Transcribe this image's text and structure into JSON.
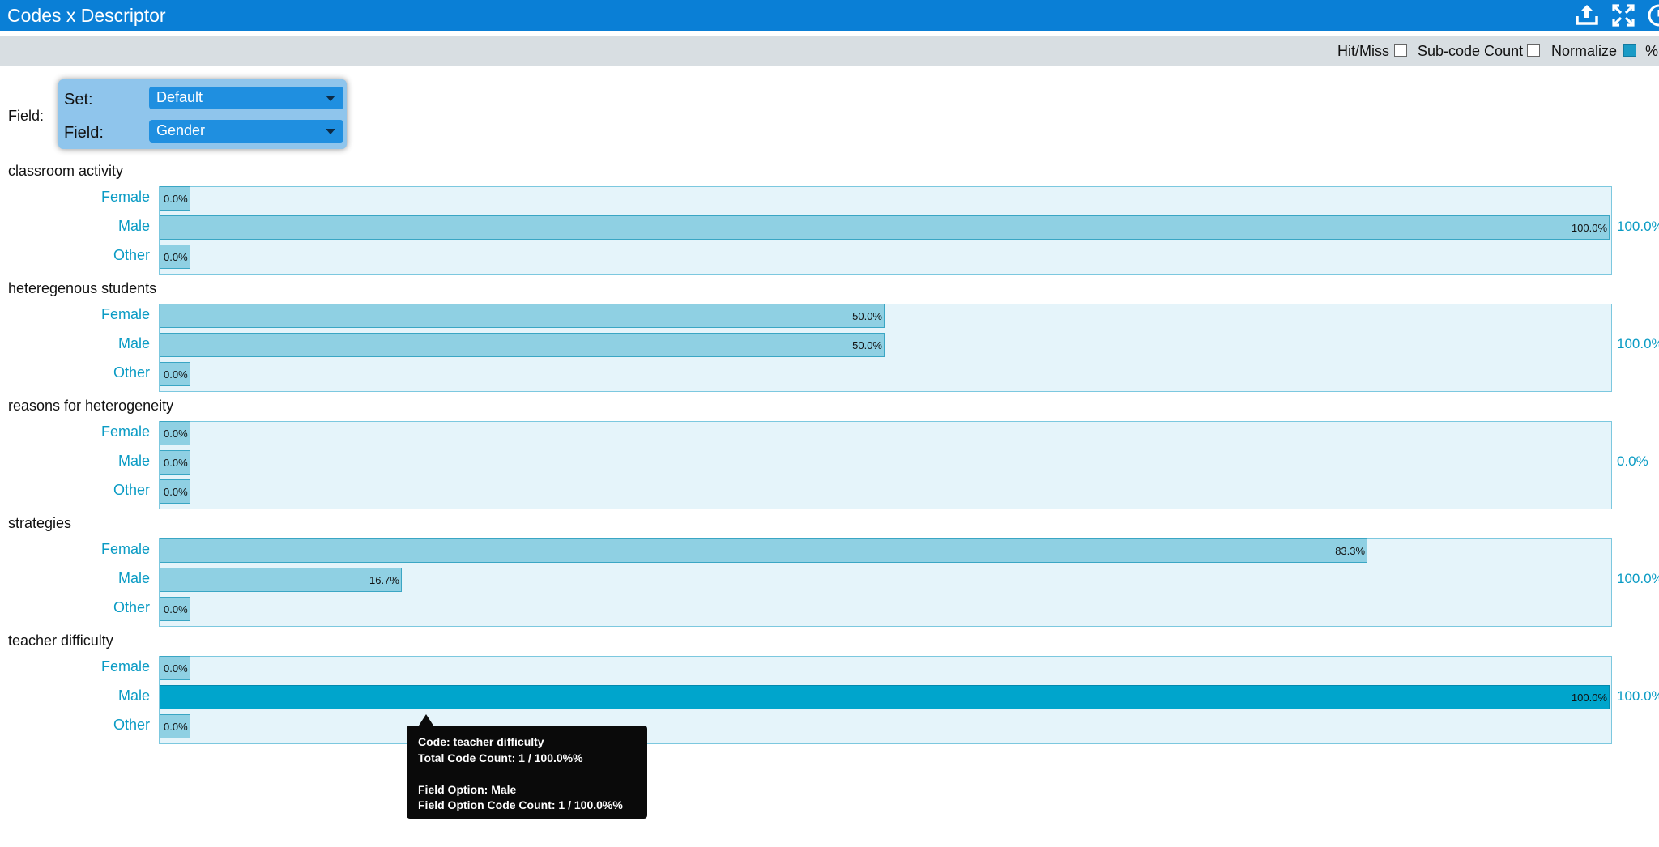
{
  "window": {
    "title": "Codes x Descriptor"
  },
  "toolbar": {
    "icons": [
      "upload-icon",
      "fullscreen-icon",
      "clock-icon"
    ]
  },
  "options": {
    "hit_miss": {
      "label": "Hit/Miss",
      "checked": false
    },
    "subcode_count": {
      "label": "Sub-code Count",
      "checked": false
    },
    "normalize": {
      "label": "Normalize",
      "checked": true
    },
    "percent": {
      "label": "%"
    }
  },
  "selector": {
    "outer_label": "Field:",
    "set_label": "Set:",
    "set_value": "Default",
    "field_label": "Field:",
    "field_value": "Gender"
  },
  "groups": [
    {
      "title": "classroom activity",
      "total": "100.0%",
      "rows": [
        {
          "label": "Female",
          "value_text": "0.0%",
          "percent": 0
        },
        {
          "label": "Male",
          "value_text": "100.0%",
          "percent": 100
        },
        {
          "label": "Other",
          "value_text": "0.0%",
          "percent": 0
        }
      ]
    },
    {
      "title": "heteregenous students",
      "total": "100.0%",
      "rows": [
        {
          "label": "Female",
          "value_text": "50.0%",
          "percent": 50
        },
        {
          "label": "Male",
          "value_text": "50.0%",
          "percent": 50
        },
        {
          "label": "Other",
          "value_text": "0.0%",
          "percent": 0
        }
      ]
    },
    {
      "title": "reasons for heterogeneity",
      "total": "0.0%",
      "rows": [
        {
          "label": "Female",
          "value_text": "0.0%",
          "percent": 0
        },
        {
          "label": "Male",
          "value_text": "0.0%",
          "percent": 0
        },
        {
          "label": "Other",
          "value_text": "0.0%",
          "percent": 0
        }
      ]
    },
    {
      "title": "strategies",
      "total": "100.0%",
      "rows": [
        {
          "label": "Female",
          "value_text": "83.3%",
          "percent": 83.3
        },
        {
          "label": "Male",
          "value_text": "16.7%",
          "percent": 16.7
        },
        {
          "label": "Other",
          "value_text": "0.0%",
          "percent": 0
        }
      ]
    },
    {
      "title": "teacher difficulty",
      "total": "100.0%",
      "rows": [
        {
          "label": "Female",
          "value_text": "0.0%",
          "percent": 0
        },
        {
          "label": "Male",
          "value_text": "100.0%",
          "percent": 100,
          "active": true
        },
        {
          "label": "Other",
          "value_text": "0.0%",
          "percent": 0
        }
      ]
    }
  ],
  "tooltip": {
    "line1": "Code: teacher difficulty",
    "line2": "Total Code Count: 1 / 100.0%%",
    "line3": "",
    "line4": "Field Option: Male",
    "line5": "Field Option Code Count: 1 / 100.0%%"
  },
  "colors": {
    "title_bar": "#0a7fd6",
    "bar_fill": "#8fd0e3",
    "bar_active": "#00a5cc",
    "label_accent": "#0a9bc4"
  }
}
